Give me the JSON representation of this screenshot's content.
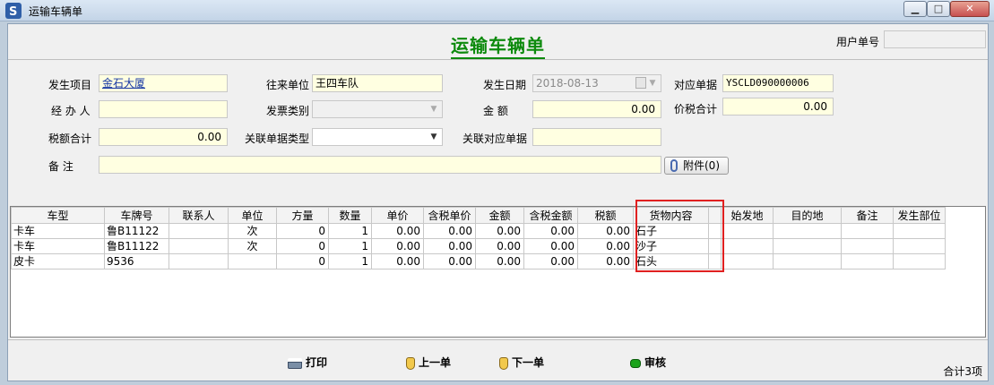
{
  "window": {
    "title": "运输车辆单",
    "minimize": "▁",
    "maximize": "□",
    "close": "✕"
  },
  "header": {
    "doc_title": "运输车辆单",
    "user_no_label": "用户单号",
    "user_no_value": ""
  },
  "form": {
    "project_label": "发生项目",
    "project_value": "金石大厦",
    "partner_label": "往来单位",
    "partner_value": "王四车队",
    "date_label": "发生日期",
    "date_value": "2018-08-13",
    "corr_doc_label": "对应单据",
    "corr_doc_value": "YSCLD090000006",
    "handler_label": "经 办 人",
    "handler_value": "",
    "invoice_type_label": "发票类别",
    "invoice_type_value": "",
    "amount_label": "金    额",
    "amount_value": "0.00",
    "total_tax_price_label": "价税合计",
    "total_tax_price_value": "0.00",
    "tax_total_label": "税额合计",
    "tax_total_value": "0.00",
    "related_type_label": "关联单据类型",
    "related_type_value": "",
    "related_doc_label": "关联对应单据",
    "related_doc_value": "",
    "remark_label": "备    注",
    "remark_value": "",
    "attach_label": "附件(0)"
  },
  "table": {
    "columns": [
      "车型",
      "车牌号",
      "联系人",
      "单位",
      "方量",
      "数量",
      "单价",
      "含税单价",
      "金额",
      "含税金额",
      "税额",
      "货物内容",
      "",
      "始发地",
      "目的地",
      "备注",
      "发生部位"
    ],
    "rows": [
      [
        "卡车",
        "鲁B11122",
        "",
        "次",
        "0",
        "1",
        "0.00",
        "0.00",
        "0.00",
        "0.00",
        "0.00",
        "石子",
        "",
        "",
        "",
        "",
        ""
      ],
      [
        "卡车",
        "鲁B11122",
        "",
        "次",
        "0",
        "1",
        "0.00",
        "0.00",
        "0.00",
        "0.00",
        "0.00",
        "沙子",
        "",
        "",
        "",
        "",
        ""
      ],
      [
        "皮卡",
        "9536",
        "",
        "",
        "0",
        "1",
        "0.00",
        "0.00",
        "0.00",
        "0.00",
        "0.00",
        "石头",
        "",
        "",
        "",
        "",
        ""
      ]
    ]
  },
  "footer": {
    "print_label": "打印",
    "prev_label": "上一单",
    "next_label": "下一单",
    "review_label": "审核",
    "total_label": "合计3项"
  },
  "colors": {
    "title_green": "#0d8a0d",
    "highlight_red": "#e02020",
    "field_yellow": "#ffffe1"
  }
}
